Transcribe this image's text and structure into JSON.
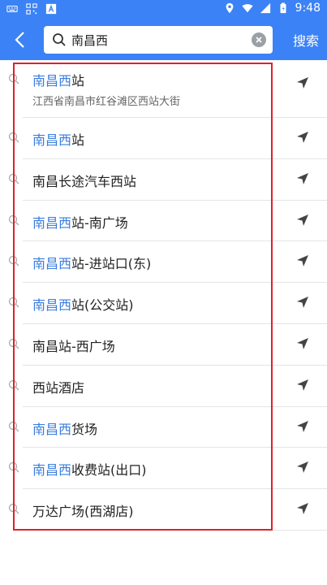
{
  "status_bar": {
    "time": "9:48",
    "colors": {
      "bg": "#3b82f6"
    }
  },
  "header": {
    "search": {
      "value": "南昌西",
      "placeholder": ""
    },
    "search_button_label": "搜索"
  },
  "results": [
    {
      "highlight": "南昌西",
      "rest": "站",
      "subtitle": "江西省南昌市红谷滩区西站大街"
    },
    {
      "highlight": "南昌西",
      "rest": "站"
    },
    {
      "highlight": "",
      "rest": "南昌长途汽车西站"
    },
    {
      "highlight": "南昌西",
      "rest": "站-南广场"
    },
    {
      "highlight": "南昌西",
      "rest": "站-进站口(东)"
    },
    {
      "highlight": "南昌西",
      "rest": "站(公交站)"
    },
    {
      "highlight": "",
      "rest": "南昌站-西广场"
    },
    {
      "highlight": "",
      "rest": "西站酒店"
    },
    {
      "highlight": "南昌西",
      "rest": "货场"
    },
    {
      "highlight": "南昌西",
      "rest": "收费站(出口)"
    },
    {
      "highlight": "",
      "rest": "万达广场(西湖店)"
    }
  ],
  "colors": {
    "accent": "#3b82f6",
    "highlight_text": "#3b7ddd",
    "frame": "#e0202a"
  }
}
